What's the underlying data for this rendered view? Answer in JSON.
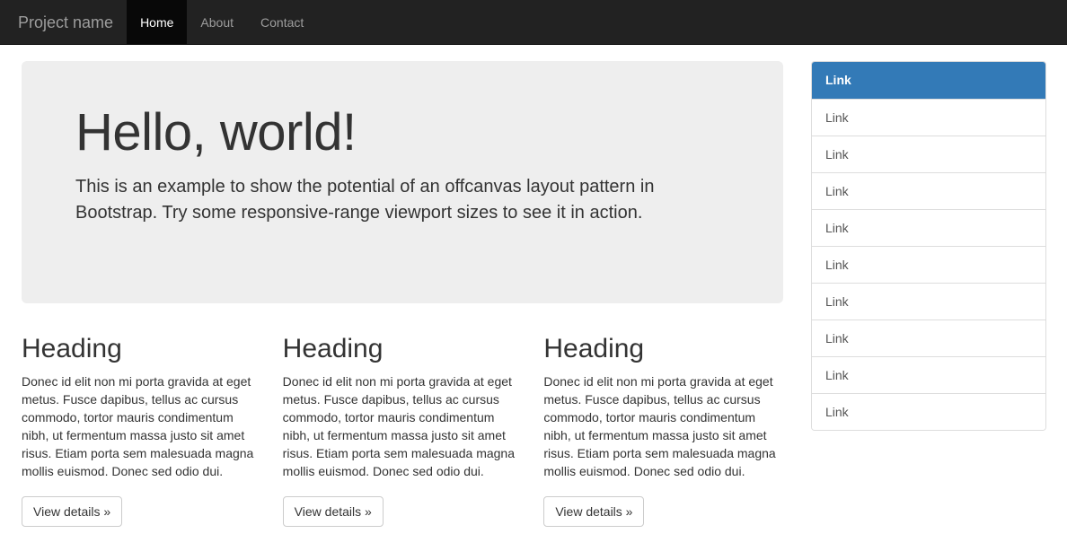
{
  "navbar": {
    "brand": "Project name",
    "items": [
      {
        "label": "Home",
        "active": true
      },
      {
        "label": "About",
        "active": false
      },
      {
        "label": "Contact",
        "active": false
      }
    ],
    "background_color": "#222222",
    "active_background_color": "#080808",
    "link_color": "#9d9d9d"
  },
  "jumbotron": {
    "title": "Hello, world!",
    "lead": "This is an example to show the potential of an offcanvas layout pattern in Bootstrap. Try some responsive-range viewport sizes to see it in action.",
    "background_color": "#eeeeee"
  },
  "sidebar": {
    "accent_color": "#337ab7",
    "items": [
      {
        "label": "Link",
        "active": true
      },
      {
        "label": "Link",
        "active": false
      },
      {
        "label": "Link",
        "active": false
      },
      {
        "label": "Link",
        "active": false
      },
      {
        "label": "Link",
        "active": false
      },
      {
        "label": "Link",
        "active": false
      },
      {
        "label": "Link",
        "active": false
      },
      {
        "label": "Link",
        "active": false
      },
      {
        "label": "Link",
        "active": false
      },
      {
        "label": "Link",
        "active": false
      }
    ]
  },
  "columns": [
    {
      "heading": "Heading",
      "body": "Donec id elit non mi porta gravida at eget metus. Fusce dapibus, tellus ac cursus commodo, tortor mauris condimentum nibh, ut fermentum massa justo sit amet risus. Etiam porta sem malesuada magna mollis euismod. Donec sed odio dui.",
      "button": "View details »"
    },
    {
      "heading": "Heading",
      "body": "Donec id elit non mi porta gravida at eget metus. Fusce dapibus, tellus ac cursus commodo, tortor mauris condimentum nibh, ut fermentum massa justo sit amet risus. Etiam porta sem malesuada magna mollis euismod. Donec sed odio dui.",
      "button": "View details »"
    },
    {
      "heading": "Heading",
      "body": "Donec id elit non mi porta gravida at eget metus. Fusce dapibus, tellus ac cursus commodo, tortor mauris condimentum nibh, ut fermentum massa justo sit amet risus. Etiam porta sem malesuada magna mollis euismod. Donec sed odio dui.",
      "button": "View details »"
    }
  ]
}
